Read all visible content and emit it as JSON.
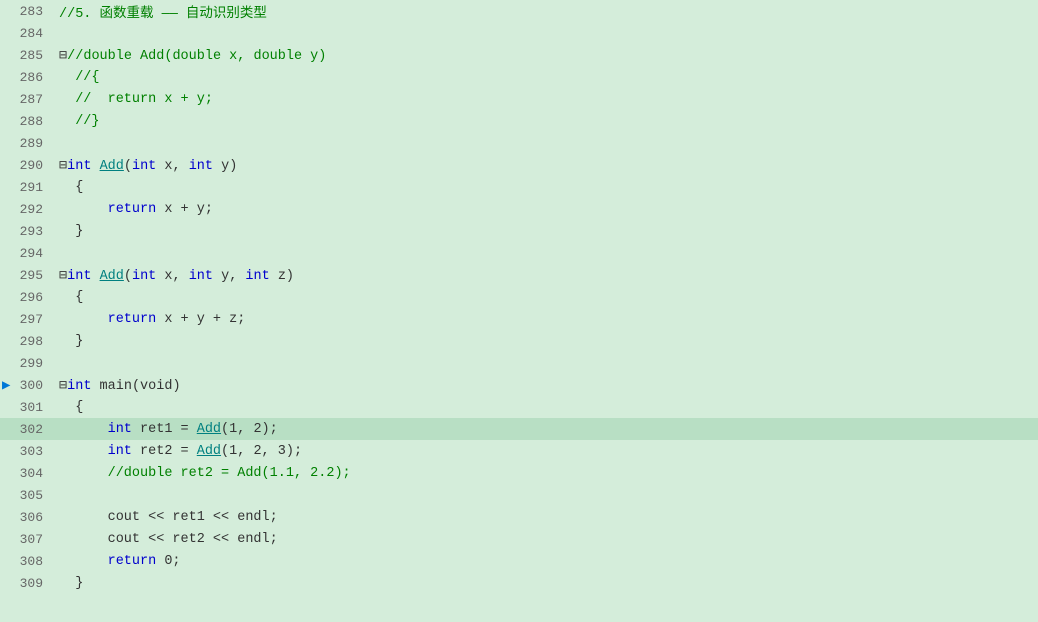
{
  "editor": {
    "background": "#d4edda",
    "lines": [
      {
        "num": "283",
        "content": [
          {
            "text": "//5. 函数重载 —— 自动识别类型",
            "class": "cm"
          }
        ]
      },
      {
        "num": "284",
        "content": []
      },
      {
        "num": "285",
        "content": [
          {
            "text": "⊟",
            "class": "op"
          },
          {
            "text": "//double Add(double x, double y)",
            "class": "cm"
          }
        ]
      },
      {
        "num": "286",
        "content": [
          {
            "text": "  //{",
            "class": "cm"
          }
        ]
      },
      {
        "num": "287",
        "content": [
          {
            "text": "  //  return x + y;",
            "class": "cm"
          }
        ]
      },
      {
        "num": "288",
        "content": [
          {
            "text": "  //}",
            "class": "cm"
          }
        ]
      },
      {
        "num": "289",
        "content": []
      },
      {
        "num": "290",
        "content": [
          {
            "text": "⊟",
            "class": "op"
          },
          {
            "text": "int",
            "class": "kw"
          },
          {
            "text": " ",
            "class": "op"
          },
          {
            "text": "Add",
            "class": "fn"
          },
          {
            "text": "(",
            "class": "op"
          },
          {
            "text": "int",
            "class": "kw"
          },
          {
            "text": " x, ",
            "class": "op"
          },
          {
            "text": "int",
            "class": "kw"
          },
          {
            "text": " y)",
            "class": "op"
          }
        ]
      },
      {
        "num": "291",
        "content": [
          {
            "text": "  {",
            "class": "op"
          }
        ]
      },
      {
        "num": "292",
        "content": [
          {
            "text": "      ",
            "class": "op"
          },
          {
            "text": "return",
            "class": "kw"
          },
          {
            "text": " x + y;",
            "class": "op"
          }
        ]
      },
      {
        "num": "293",
        "content": [
          {
            "text": "  }",
            "class": "op"
          }
        ]
      },
      {
        "num": "294",
        "content": []
      },
      {
        "num": "295",
        "content": [
          {
            "text": "⊟",
            "class": "op"
          },
          {
            "text": "int",
            "class": "kw"
          },
          {
            "text": " ",
            "class": "op"
          },
          {
            "text": "Add",
            "class": "fn"
          },
          {
            "text": "(",
            "class": "op"
          },
          {
            "text": "int",
            "class": "kw"
          },
          {
            "text": " x, ",
            "class": "op"
          },
          {
            "text": "int",
            "class": "kw"
          },
          {
            "text": " y, ",
            "class": "op"
          },
          {
            "text": "int",
            "class": "kw"
          },
          {
            "text": " z)",
            "class": "op"
          }
        ]
      },
      {
        "num": "296",
        "content": [
          {
            "text": "  {",
            "class": "op"
          }
        ]
      },
      {
        "num": "297",
        "content": [
          {
            "text": "      ",
            "class": "op"
          },
          {
            "text": "return",
            "class": "kw"
          },
          {
            "text": " x + y + z;",
            "class": "op"
          }
        ]
      },
      {
        "num": "298",
        "content": [
          {
            "text": "  }",
            "class": "op"
          }
        ]
      },
      {
        "num": "299",
        "content": []
      },
      {
        "num": "300",
        "content": [
          {
            "text": "⊟",
            "class": "op"
          },
          {
            "text": "int",
            "class": "kw"
          },
          {
            "text": " main(void)",
            "class": "op"
          }
        ]
      },
      {
        "num": "301",
        "content": [
          {
            "text": "  {",
            "class": "op"
          }
        ]
      },
      {
        "num": "302",
        "content": [
          {
            "text": "      ",
            "class": "op"
          },
          {
            "text": "int",
            "class": "kw"
          },
          {
            "text": " ret1 = ",
            "class": "op"
          },
          {
            "text": "Add",
            "class": "fn"
          },
          {
            "text": "(1, 2);",
            "class": "op"
          }
        ],
        "highlighted": true
      },
      {
        "num": "303",
        "content": [
          {
            "text": "      ",
            "class": "op"
          },
          {
            "text": "int",
            "class": "kw"
          },
          {
            "text": " ret2 = ",
            "class": "op"
          },
          {
            "text": "Add",
            "class": "fn"
          },
          {
            "text": "(1, 2, 3);",
            "class": "op"
          }
        ]
      },
      {
        "num": "304",
        "content": [
          {
            "text": "      ",
            "class": "cm"
          },
          {
            "text": "//double ret2 = Add(1.1, 2.2);",
            "class": "cm"
          }
        ]
      },
      {
        "num": "305",
        "content": []
      },
      {
        "num": "306",
        "content": [
          {
            "text": "      cout << ret1 << endl;",
            "class": "op"
          }
        ]
      },
      {
        "num": "307",
        "content": [
          {
            "text": "      cout << ret2 << endl;",
            "class": "op"
          }
        ]
      },
      {
        "num": "308",
        "content": [
          {
            "text": "      ",
            "class": "op"
          },
          {
            "text": "return",
            "class": "kw"
          },
          {
            "text": " 0;",
            "class": "op"
          }
        ]
      },
      {
        "num": "309",
        "content": [
          {
            "text": "  }",
            "class": "op"
          }
        ]
      }
    ],
    "arrow_line": "300"
  }
}
